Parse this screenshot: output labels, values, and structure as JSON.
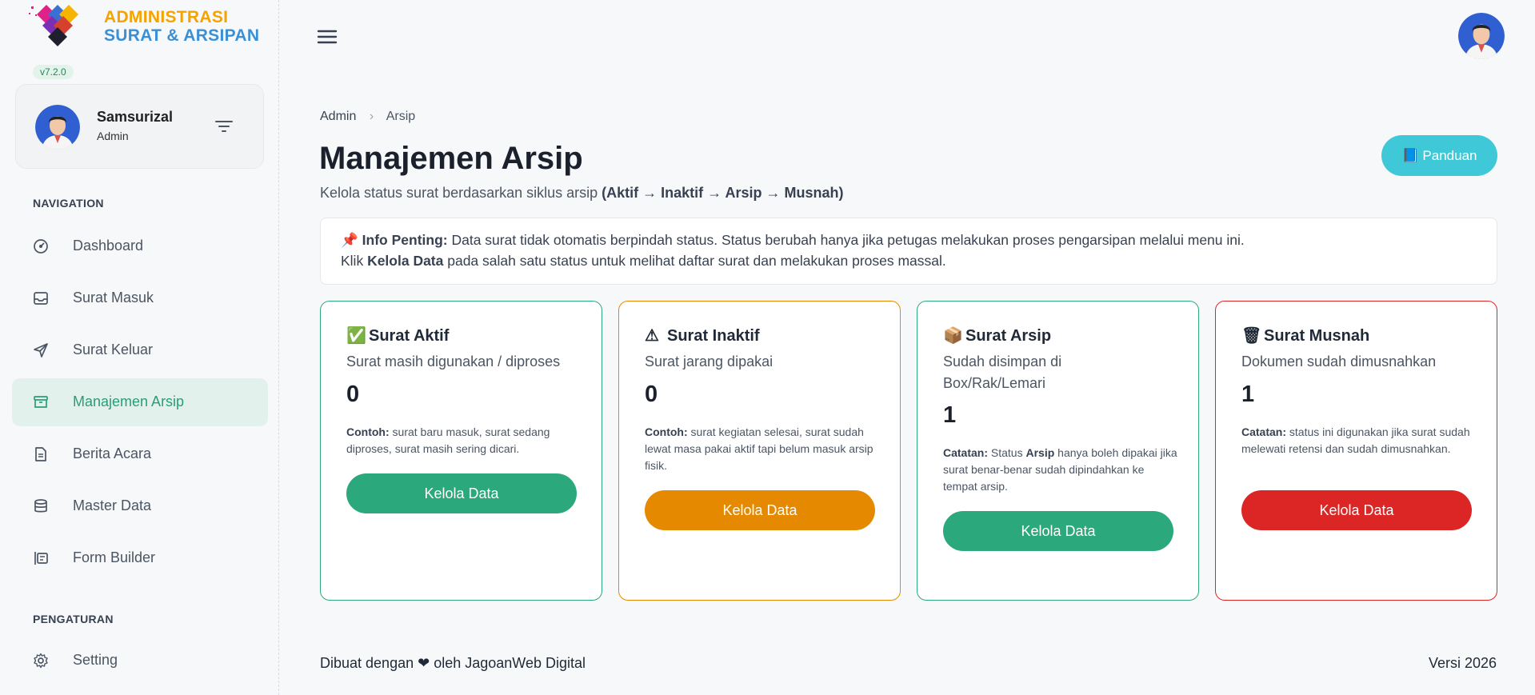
{
  "brand": {
    "line1": "ADMINISTRASI",
    "line2": "SURAT & ARSIPAN",
    "version": "v7.2.0",
    "colors": {
      "orange": "#f4a300",
      "blue": "#3b8fd4",
      "accent": "#2a9d74"
    }
  },
  "user": {
    "name": "Samsurizal",
    "role": "Admin"
  },
  "sidebar": {
    "nav_heading": "NAVIGATION",
    "items": [
      {
        "label": "Dashboard",
        "icon": "gauge-icon",
        "active": false
      },
      {
        "label": "Surat Masuk",
        "icon": "inbox-icon",
        "active": false
      },
      {
        "label": "Surat Keluar",
        "icon": "send-icon",
        "active": false
      },
      {
        "label": "Manajemen Arsip",
        "icon": "archive-icon",
        "active": true
      },
      {
        "label": "Berita Acara",
        "icon": "document-icon",
        "active": false
      },
      {
        "label": "Master Data",
        "icon": "database-icon",
        "active": false
      },
      {
        "label": "Form Builder",
        "icon": "form-icon",
        "active": false
      }
    ],
    "settings_heading": "PENGATURAN",
    "settings_items": [
      {
        "label": "Setting",
        "icon": "gear-icon"
      }
    ]
  },
  "breadcrumb": {
    "root": "Admin",
    "current": "Arsip"
  },
  "page": {
    "title": "Manajemen Arsip",
    "subtitle_prefix": "Kelola status surat berdasarkan siklus arsip ",
    "subtitle_bold": "(Aktif → Inaktif → Arsip → Musnah)",
    "guide_button": "📘 Panduan"
  },
  "info": {
    "pin": "📌",
    "label": "Info Penting:",
    "text1": " Data surat tidak otomatis berpindah status. Status berubah hanya jika petugas melakukan proses pengarsipan melalui menu ini.",
    "line2_prefix": "Klik ",
    "line2_bold": "Kelola Data",
    "line2_suffix": " pada salah satu status untuk melihat daftar surat dan melakukan proses massal."
  },
  "cards": [
    {
      "emoji": "✅",
      "title": "Surat Aktif",
      "desc": "Surat masih digunakan / diproses",
      "count": "0",
      "note_label": "Contoh:",
      "note_text": " surat baru masuk, surat sedang diproses, surat masih sering dicari.",
      "button": "Kelola Data",
      "color": "#2ba97c"
    },
    {
      "emoji": "⚠",
      "title": "Surat Inaktif",
      "desc": "Surat jarang dipakai",
      "count": "0",
      "note_label": "Contoh:",
      "note_text": " surat kegiatan selesai, surat sudah lewat masa pakai aktif tapi belum masuk arsip fisik.",
      "button": "Kelola Data",
      "color": "#e58a00"
    },
    {
      "emoji": "📦",
      "title": "Surat Arsip",
      "desc": "Sudah disimpan di Box/Rak/Lemari",
      "count": "1",
      "note_label": "Catatan:",
      "note_text_pre": " Status ",
      "note_text_bold": "Arsip",
      "note_text": " hanya boleh dipakai jika surat benar-benar sudah dipindahkan ke tempat arsip.",
      "button": "Kelola Data",
      "color": "#2ba97c"
    },
    {
      "emoji": "🗑",
      "title": "Surat Musnah",
      "desc": "Dokumen sudah dimusnahkan",
      "count": "1",
      "note_label": "Catatan:",
      "note_text": " status ini digunakan jika surat sudah melewati retensi dan sudah dimusnahkan.",
      "button": "Kelola Data",
      "color": "#dc2626"
    }
  ],
  "footer": {
    "left_prefix": "Dibuat dengan ",
    "heart": "❤",
    "left_suffix": " oleh JagoanWeb Digital",
    "right": "Versi 2026"
  }
}
